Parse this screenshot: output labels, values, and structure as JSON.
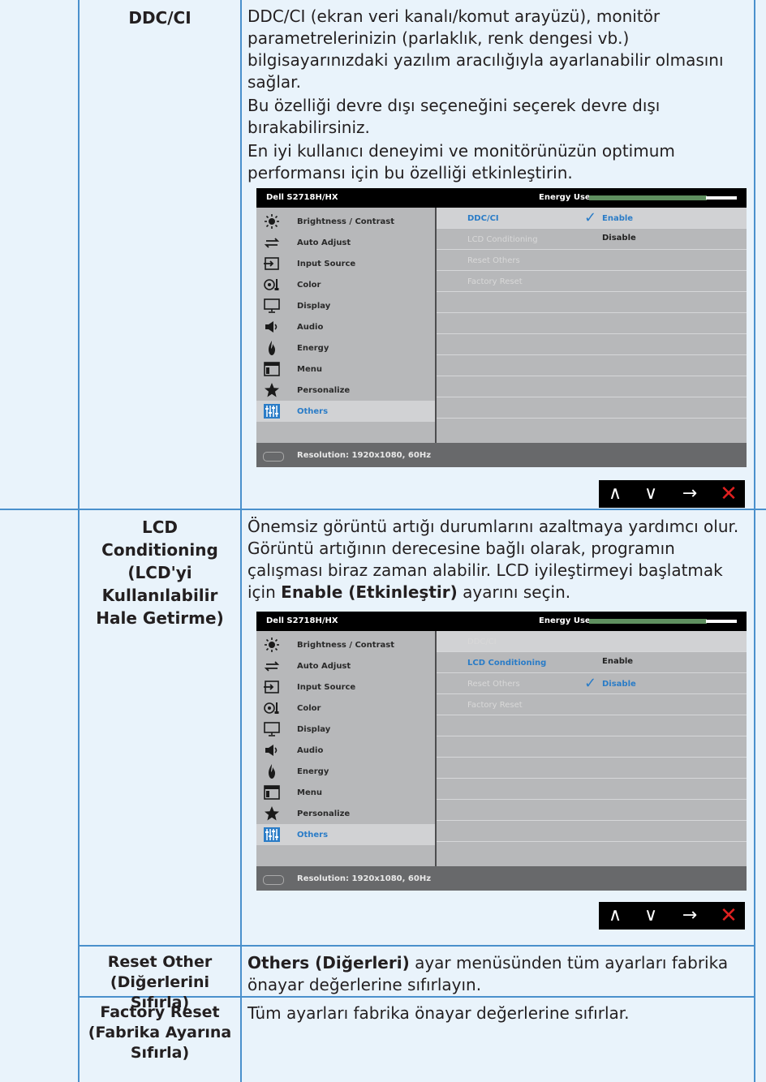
{
  "rows": [
    {
      "name": "DDC/CI",
      "paragraphs": [
        "DDC/CI (ekran veri kanalı/komut arayüzü), monitör parametrelerinizin (parlaklık, renk dengesi vb.) bilgisayarınızdaki yazılım aracılığıyla ayarlanabilir olmasını sağlar.",
        "Bu özelliği devre dışı seçeneğini seçerek devre dışı bırakabilirsiniz.",
        "En iyi kullanıcı deneyimi ve monitörünüzün optimum performansı için bu özelliği etkinleştirin."
      ]
    },
    {
      "name_lines": [
        "LCD",
        "Conditioning",
        "(LCD'yi",
        "Kullanılabilir",
        "Hale Getirme)"
      ],
      "text_before": "Önemsiz görüntü artığı durumlarını azaltmaya yardımcı olur. Görüntü artığının derecesine bağlı olarak, programın çalışması biraz zaman alabilir. LCD iyileştirmeyi başlatmak için ",
      "text_bold": "Enable (Etkinleştir)",
      "text_after": " ayarını seçin."
    },
    {
      "name_lines": [
        "Reset Other",
        "(Diğerlerini",
        "Sıfırla)"
      ],
      "text_bold": "Others (Diğerleri)",
      "text_after": " ayar menüsünden tüm ayarları fabrika önayar değerlerine sıfırlayın."
    },
    {
      "name_lines": [
        "Factory Reset",
        "(Fabrika Ayarına",
        "Sıfırla)"
      ],
      "text": "Tüm ayarları fabrika önayar değerlerine sıfırlar."
    }
  ],
  "osd": {
    "model": "Dell S2718H/HX",
    "energy_label": "Energy Use",
    "energy_level": 0.78,
    "menu": [
      "Brightness / Contrast",
      "Auto Adjust",
      "Input Source",
      "Color",
      "Display",
      "Audio",
      "Energy",
      "Menu",
      "Personalize",
      "Others"
    ],
    "menu_icons": [
      "brightness-icon",
      "auto-adjust-icon",
      "input-source-icon",
      "color-icon",
      "display-icon",
      "audio-icon",
      "energy-icon",
      "menu-icon",
      "personalize-star-icon",
      "others-sliders-icon"
    ],
    "selected_menu": "Others",
    "options": [
      "DDC/CI",
      "LCD Conditioning",
      "Reset Others",
      "Factory Reset"
    ],
    "resolution": "Resolution: 1920x1080, 60Hz",
    "osd1": {
      "active_option": "DDC/CI",
      "val1": "Enable",
      "val2": "Disable"
    },
    "osd2": {
      "active_option": "LCD Conditioning",
      "val1": "Enable",
      "val2": "Disable"
    }
  },
  "nav": {
    "up": "∧",
    "down": "∨",
    "right": "→",
    "close": "✕"
  },
  "colors": {
    "accent": "#2a7cc7",
    "grid": "#4a90cc",
    "background": "#e9f3fb"
  }
}
